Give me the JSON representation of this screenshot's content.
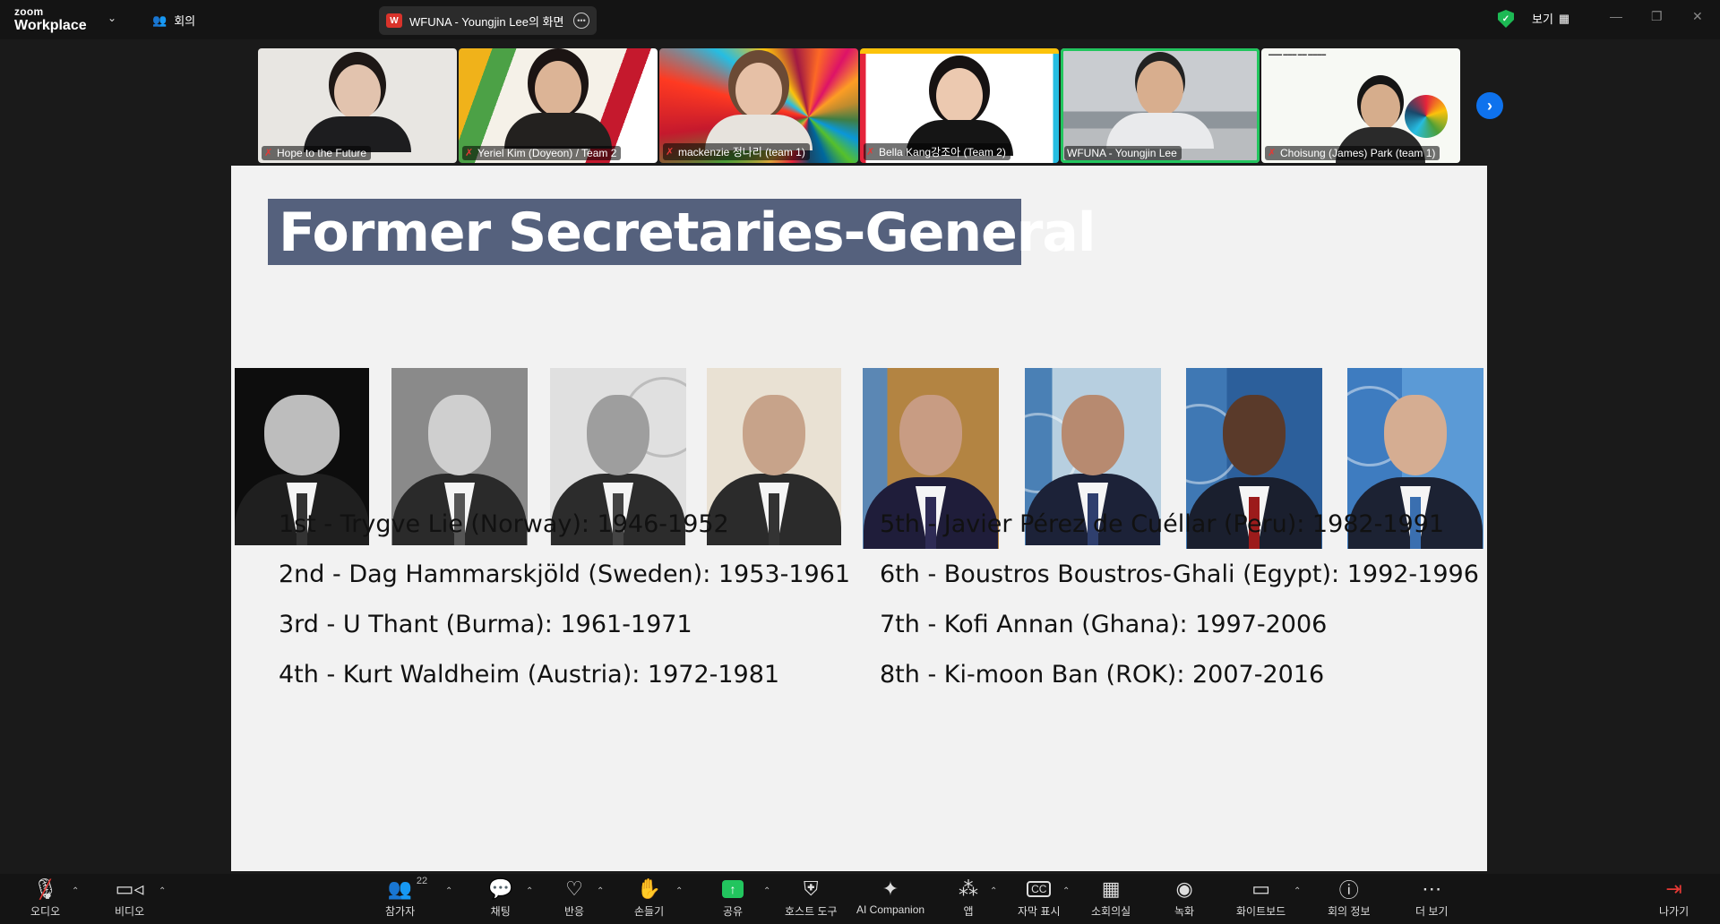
{
  "app": {
    "brand_top": "zoom",
    "brand_bottom": "Workplace",
    "meeting_tab": "회의",
    "share_tab": "WFUNA - Youngjin Lee의 화면",
    "share_badge": "W",
    "view_label": "보기"
  },
  "participants": [
    {
      "name": "Hope to the Future",
      "muted": true
    },
    {
      "name": "Yeriel Kim (Doyeon) / Team 2",
      "muted": true
    },
    {
      "name": "mackenzie 정나리 (team 1)",
      "muted": true
    },
    {
      "name": "Bella Kang강조아 (Team 2)",
      "muted": true
    },
    {
      "name": "WFUNA - Youngjin Lee",
      "muted": false
    },
    {
      "name": "Choisung (James) Park (team 1)",
      "muted": true
    }
  ],
  "slide": {
    "title": "Former Secretaries-General",
    "left_list": [
      "1st - Trygve Lie (Norway): 1946-1952",
      "2nd - Dag Hammarskjöld (Sweden): 1953-1961",
      "3rd - U Thant (Burma): 1961-1971",
      "4th - Kurt Waldheim (Austria): 1972-1981"
    ],
    "right_list": [
      "5th - Javier Pérez de Cuéllar (Peru): 1982-1991",
      "6th - Boustros Boustros-Ghali (Egypt): 1992-1996",
      "7th - Kofi Annan (Ghana): 1997-2006",
      "8th - Ki-moon Ban (ROK): 2007-2016"
    ]
  },
  "toolbar": {
    "audio": "오디오",
    "video": "비디오",
    "participants": "참가자",
    "participants_count": "22",
    "chat": "채팅",
    "reactions": "반응",
    "raise_hand": "손들기",
    "share": "공유",
    "host_tools": "호스트 도구",
    "ai_companion": "AI Companion",
    "apps": "앱",
    "captions": "자막 표시",
    "breakout": "소회의실",
    "record": "녹화",
    "whiteboard": "화이트보드",
    "info": "회의 정보",
    "more": "더 보기",
    "leave": "나가기"
  },
  "colors": {
    "title_bar": "#55617d",
    "active_speaker": "#22c55e",
    "accent": "#0e72ed"
  }
}
